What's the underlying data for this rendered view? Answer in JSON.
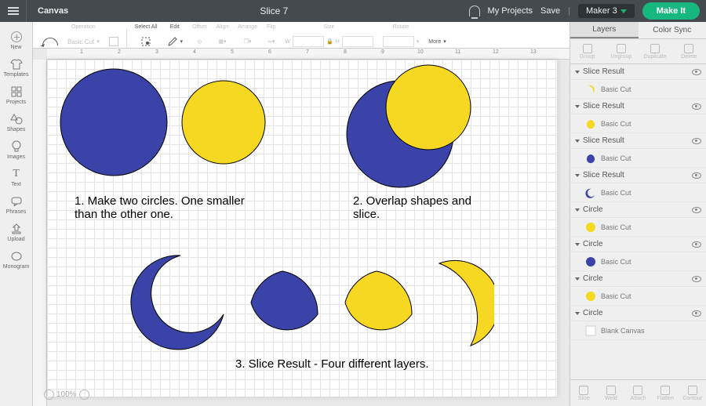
{
  "topbar": {
    "canvas_label": "Canvas",
    "title": "Slice 7",
    "my_projects": "My Projects",
    "save": "Save",
    "machine": "Maker 3",
    "make_it": "Make It"
  },
  "leftrail": [
    {
      "label": "New"
    },
    {
      "label": "Templates"
    },
    {
      "label": "Projects"
    },
    {
      "label": "Shapes"
    },
    {
      "label": "Images"
    },
    {
      "label": "Text"
    },
    {
      "label": "Phrases"
    },
    {
      "label": "Upload"
    },
    {
      "label": "Monogram"
    }
  ],
  "toolbar": {
    "operation": "Operation",
    "basic_cut": "Basic Cut",
    "select_all": "Select All",
    "edit": "Edit",
    "offset": "Offset",
    "align": "Align",
    "arrange": "Arrange",
    "flip": "Flip",
    "size": "Size",
    "w": "W",
    "h": "H",
    "rotate": "Rotate",
    "more": "More"
  },
  "captions": {
    "c1": "1. Make two circles. One smaller\nthan the other one.",
    "c2": "2. Overlap shapes and\nslice.",
    "c3": "3. Slice Result - Four different layers."
  },
  "zoom": "100%",
  "rp": {
    "tab_layers": "Layers",
    "tab_color": "Color Sync",
    "actions": {
      "group": "Group",
      "ungroup": "Ungroup",
      "duplicate": "Duplicate",
      "delete": "Delete"
    },
    "bottom": {
      "slice": "Slice",
      "weld": "Weld",
      "attach": "Attach",
      "flatten": "Flatten",
      "contour": "Contour"
    }
  },
  "layers": [
    {
      "name": "Slice Result",
      "op": "Basic Cut",
      "icon": "crescent",
      "color": "#f6d822"
    },
    {
      "name": "Slice Result",
      "op": "Basic Cut",
      "icon": "lemon",
      "color": "#f6d822"
    },
    {
      "name": "Slice Result",
      "op": "Basic Cut",
      "icon": "lemon",
      "color": "#3a44a8"
    },
    {
      "name": "Slice Result",
      "op": "Basic Cut",
      "icon": "moon",
      "color": "#3a44a8"
    },
    {
      "name": "Circle",
      "op": "Basic Cut",
      "icon": "circle",
      "color": "#f6d822"
    },
    {
      "name": "Circle",
      "op": "Basic Cut",
      "icon": "circle",
      "color": "#3a44a8"
    },
    {
      "name": "Circle",
      "op": "Basic Cut",
      "icon": "circle",
      "color": "#f6d822"
    },
    {
      "name": "Circle",
      "op": "Blank Canvas",
      "icon": "square",
      "color": "#ffffff"
    }
  ],
  "colors": {
    "blue": "#3a44a8",
    "yellow": "#f6d822"
  }
}
